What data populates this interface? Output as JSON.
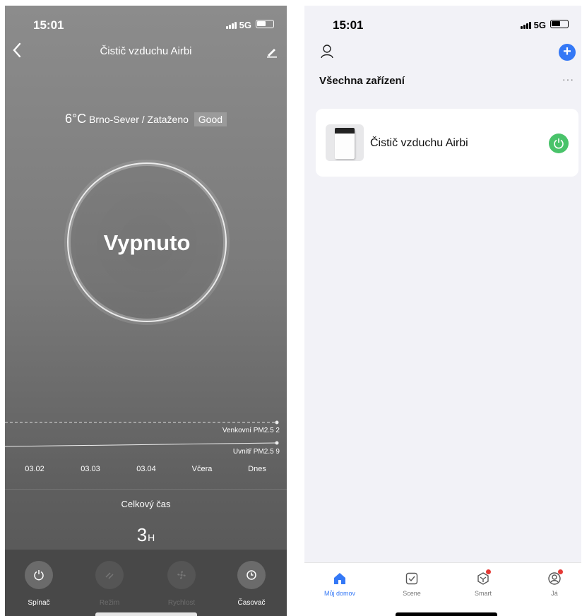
{
  "left_screen": {
    "status_bar": {
      "time": "15:01",
      "network": "5G"
    },
    "title": "Čistič vzduchu Airbi",
    "weather": {
      "temperature": "6°C",
      "location_condition": "Brno-Sever / Zataženo",
      "air_quality": "Good"
    },
    "device_state": "Vypnuto",
    "pm_chart": {
      "outdoor_label": "Venkovní PM2.5 2",
      "indoor_label": "Uvnitř PM2.5 9",
      "dates": [
        "03.02",
        "03.03",
        "03.04",
        "Včera",
        "Dnes"
      ]
    },
    "total_time": {
      "label": "Celkový čas",
      "value": "3",
      "unit": "H"
    },
    "controls": [
      {
        "label": "Spínač",
        "icon": "power-icon",
        "enabled": true
      },
      {
        "label": "Režim",
        "icon": "mode-icon",
        "enabled": false
      },
      {
        "label": "Rychlost",
        "icon": "fan-icon",
        "enabled": false
      },
      {
        "label": "Časovač",
        "icon": "clock-icon",
        "enabled": true
      }
    ]
  },
  "right_screen": {
    "status_bar": {
      "time": "15:01",
      "network": "5G"
    },
    "add_button": "+",
    "section_title": "Všechna zařízení",
    "more": "···",
    "devices": [
      {
        "name": "Čistič vzduchu Airbi",
        "power_color": "#49c36a"
      }
    ],
    "tabs": [
      {
        "label": "Můj domov",
        "icon": "home-icon",
        "active": true
      },
      {
        "label": "Scene",
        "icon": "scene-icon",
        "active": false
      },
      {
        "label": "Smart",
        "icon": "smart-icon",
        "active": false,
        "badge": true
      },
      {
        "label": "Já",
        "icon": "profile-icon",
        "active": false,
        "badge": true
      }
    ],
    "accent_color": "#3478f6"
  }
}
